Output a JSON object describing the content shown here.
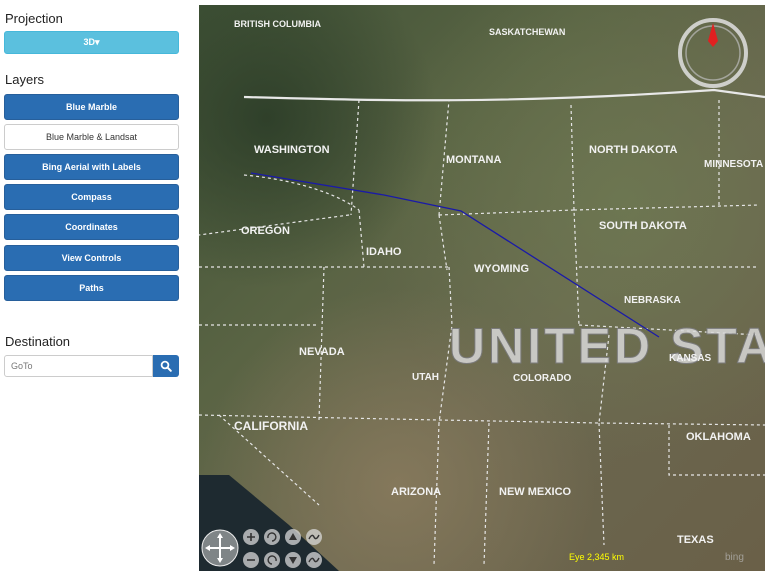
{
  "sidebar": {
    "projection_title": "Projection",
    "projection_button": "3D▾",
    "layers_title": "Layers",
    "layers": [
      {
        "label": "Blue Marble",
        "active": true
      },
      {
        "label": "Blue Marble & Landsat",
        "active": false
      },
      {
        "label": "Bing Aerial with Labels",
        "active": true
      },
      {
        "label": "Compass",
        "active": true
      },
      {
        "label": "Coordinates",
        "active": true
      },
      {
        "label": "View Controls",
        "active": true
      },
      {
        "label": "Paths",
        "active": true
      }
    ],
    "destination_title": "Destination",
    "goto_placeholder": "GoTo"
  },
  "map": {
    "labels": {
      "british_columbia": "BRITISH COLUMBIA",
      "saskatchewan": "SASKATCHEWAN",
      "washington": "WASHINGTON",
      "montana": "MONTANA",
      "north_dakota": "NORTH DAKOTA",
      "minnesota": "MINNESOTA",
      "oregon": "OREGON",
      "idaho": "IDAHO",
      "south_dakota": "SOUTH DAKOTA",
      "wyoming": "WYOMING",
      "nebraska": "NEBRASKA",
      "united_states": "UNITED STA",
      "nevada": "NEVADA",
      "utah": "UTAH",
      "colorado": "COLORADO",
      "kansas": "KANSAS",
      "california": "CALIFORNIA",
      "oklahoma": "OKLAHOMA",
      "arizona": "ARIZONA",
      "new_mexico": "NEW MEXICO",
      "texas": "TEXAS"
    },
    "eye_altitude": "Eye  2,345 km",
    "bing_logo": "bing",
    "path_color": "#1a1aa8",
    "compass_needle_color": "#e02020"
  }
}
